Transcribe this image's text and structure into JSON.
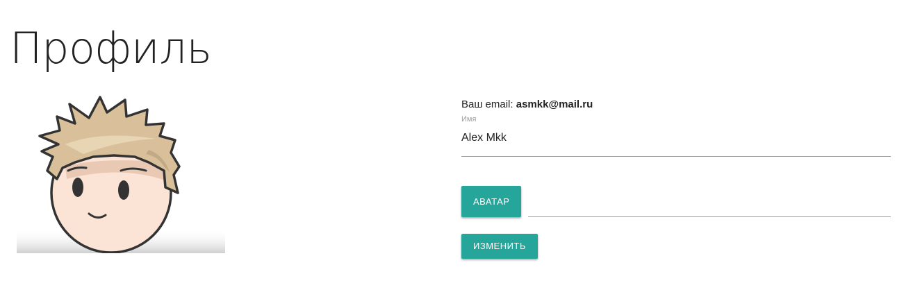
{
  "page": {
    "title": "Профиль"
  },
  "avatar": {
    "icon": "cartoon-boy-avatar-icon"
  },
  "profile": {
    "email_label": "Ваш email:",
    "email_value": "asmkk@mail.ru",
    "name_label": "Имя",
    "name_value": "Alex Mkk"
  },
  "actions": {
    "avatar_button": "Аватар",
    "submit_button": "Изменить"
  },
  "colors": {
    "accent": "#26a69a",
    "text": "#212121",
    "muted": "#9e9e9e"
  }
}
